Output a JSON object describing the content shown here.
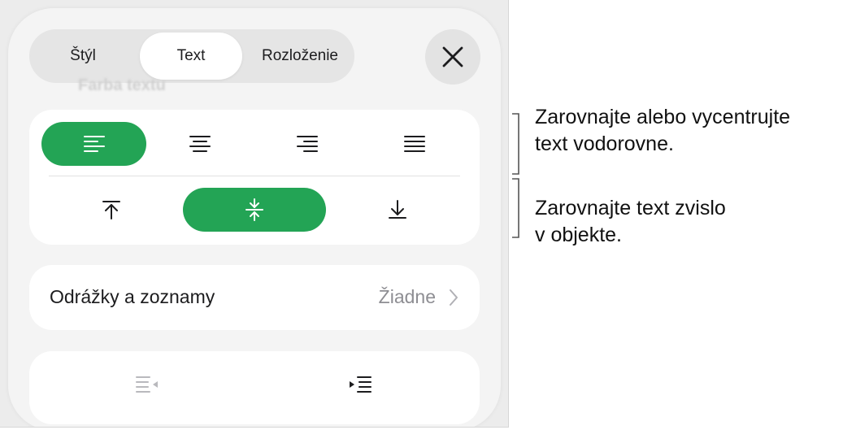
{
  "segmented": {
    "ghost_text": "Farba textu",
    "tabs": [
      {
        "label": "Štýl",
        "active": false
      },
      {
        "label": "Text",
        "active": true
      },
      {
        "label": "Rozloženie",
        "active": false
      }
    ]
  },
  "horizontal_alignment": {
    "options": [
      "align-left",
      "align-center",
      "align-right",
      "justify"
    ],
    "selected": "align-left"
  },
  "vertical_alignment": {
    "options": [
      "align-top",
      "align-middle",
      "align-bottom"
    ],
    "selected": "align-middle"
  },
  "bullets": {
    "label": "Odrážky a zoznamy",
    "value": "Žiadne"
  },
  "indent": {
    "decrease_enabled": false,
    "increase_enabled": true
  },
  "annotations": {
    "horizontal": {
      "line1": "Zarovnajte alebo vycentrujte",
      "line2": "text vodorovne."
    },
    "vertical": {
      "line1": "Zarovnajte text zvislo",
      "line2": "v objekte."
    }
  },
  "colors": {
    "accent": "#23a455",
    "panel": "#f4f4f4",
    "card": "#ffffff",
    "secondary_text": "#8e8e93"
  }
}
